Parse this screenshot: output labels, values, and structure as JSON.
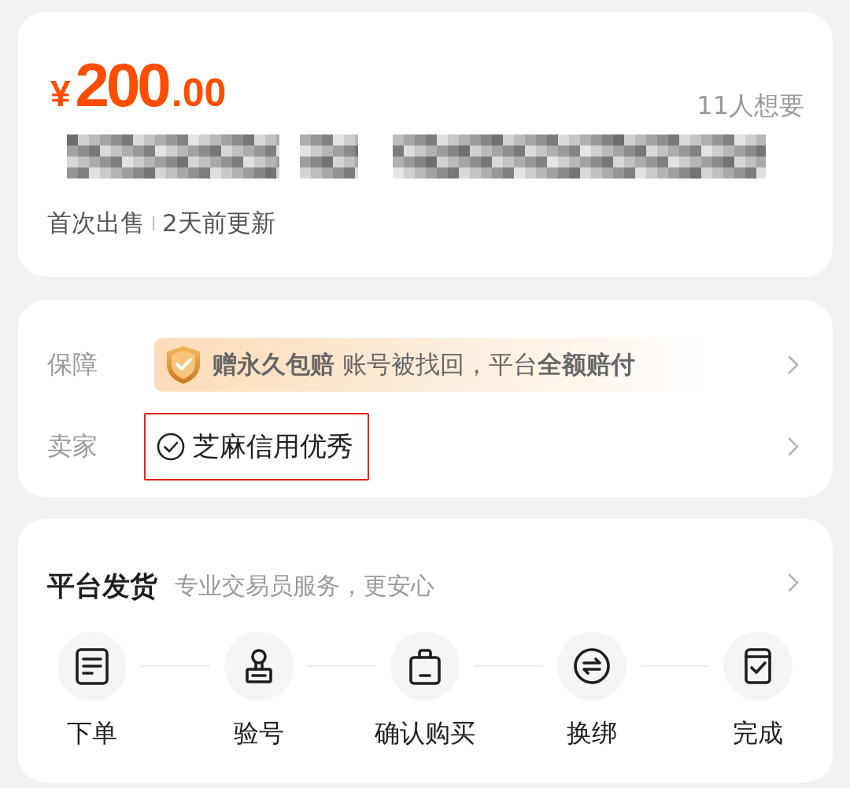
{
  "listing": {
    "price": {
      "currency": "¥",
      "integer": "200",
      "decimal": ".00"
    },
    "want_count": "11人想要",
    "title_redacted": true,
    "meta": [
      "首次出售",
      "2天前更新"
    ]
  },
  "info": {
    "rows": [
      {
        "kind": "guarantee",
        "label": "保障",
        "text": "**赠永久包赔** 账号被找回，平台**全额赔付**"
      },
      {
        "kind": "seller",
        "label": "卖家",
        "text": "芝麻信用优秀",
        "highlighted": true
      }
    ]
  },
  "delivery": {
    "title": "平台发货",
    "subtitle": "专业交易员服务，更安心",
    "steps": [
      {
        "label": "下单"
      },
      {
        "label": "验号"
      },
      {
        "label": "确认购买"
      },
      {
        "label": "换绑"
      },
      {
        "label": "完成"
      }
    ]
  }
}
